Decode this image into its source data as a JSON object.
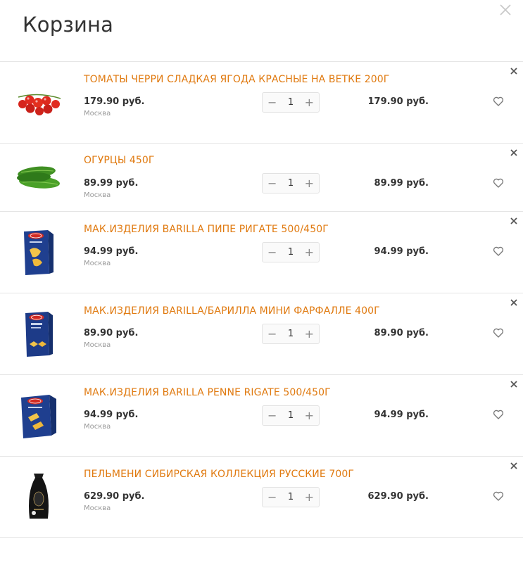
{
  "header": {
    "title": "Корзина"
  },
  "colors": {
    "accent": "#e07a10",
    "text": "#333333",
    "muted": "#999999"
  },
  "items": [
    {
      "name": "ТОМАТЫ ЧЕРРИ СЛАДКАЯ ЯГОДА КРАСНЫЕ НА ВЕТКЕ 200Г",
      "price": "179.90 руб.",
      "city": "Москва",
      "qty": "1",
      "total": "179.90 руб.",
      "image": "cherry-tomatoes"
    },
    {
      "name": "ОГУРЦЫ 450Г",
      "price": "89.99 руб.",
      "city": "Москва",
      "qty": "1",
      "total": "89.99 руб.",
      "image": "cucumbers"
    },
    {
      "name": "МАК.ИЗДЕЛИЯ BARILLA ПИПЕ РИГАТЕ 500/450Г",
      "price": "94.99 руб.",
      "city": "Москва",
      "qty": "1",
      "total": "94.99 руб.",
      "image": "barilla-box"
    },
    {
      "name": "МАК.ИЗДЕЛИЯ BARILLA/БАРИЛЛА МИНИ ФАРФАЛЛЕ 400Г",
      "price": "89.90 руб.",
      "city": "Москва",
      "qty": "1",
      "total": "89.90 руб.",
      "image": "barilla-box"
    },
    {
      "name": "МАК.ИЗДЕЛИЯ BARILLA PENNE RIGATE 500/450Г",
      "price": "94.99 руб.",
      "city": "Москва",
      "qty": "1",
      "total": "94.99 руб.",
      "image": "barilla-box"
    },
    {
      "name": "ПЕЛЬМЕНИ СИБИРСКАЯ КОЛЛЕКЦИЯ РУССКИЕ 700Г",
      "price": "629.90 руб.",
      "city": "Москва",
      "qty": "1",
      "total": "629.90 руб.",
      "image": "dumplings-bag"
    }
  ],
  "icons": {
    "close": "close-icon",
    "remove": "remove-icon",
    "minus": "minus-icon",
    "plus": "plus-icon",
    "favorite": "heart-icon"
  }
}
